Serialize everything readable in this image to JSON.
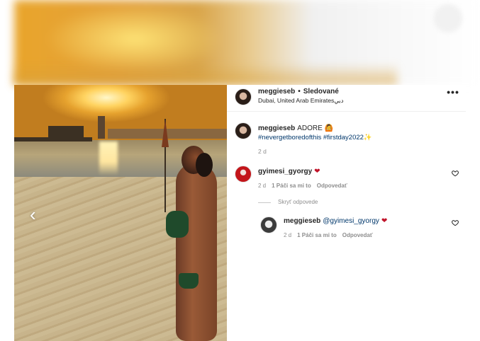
{
  "post": {
    "username": "meggieseb",
    "separator": "•",
    "follow_status": "Sledované",
    "location": "Dubai, United Arab Emiratesدبي",
    "more_glyph": "•••"
  },
  "caption": {
    "username": "meggieseb",
    "text": "ADORE 🙆",
    "hashtags": "#nevergetboredofthis #firstday2022✨",
    "time": "2 d"
  },
  "comment": {
    "username": "gyimesi_gyorgy",
    "heart": "❤",
    "time": "2 d",
    "likes": "1 Páči sa mi to",
    "reply": "Odpovedať"
  },
  "hide_replies": "Skryť odpovede",
  "reply": {
    "username": "meggieseb",
    "mention": "@gyimesi_gyorgy",
    "heart": "❤",
    "time": "2 d",
    "likes": "1 Páči sa mi to",
    "reply": "Odpovedať"
  },
  "nav": {
    "prev_glyph": "‹"
  },
  "icons": {
    "like": "heart-outline-icon",
    "more": "more-options-icon",
    "prev": "chevron-left-icon"
  },
  "colors": {
    "link": "#00376b",
    "muted": "#8e8e8e",
    "heart": "#c0142a"
  }
}
